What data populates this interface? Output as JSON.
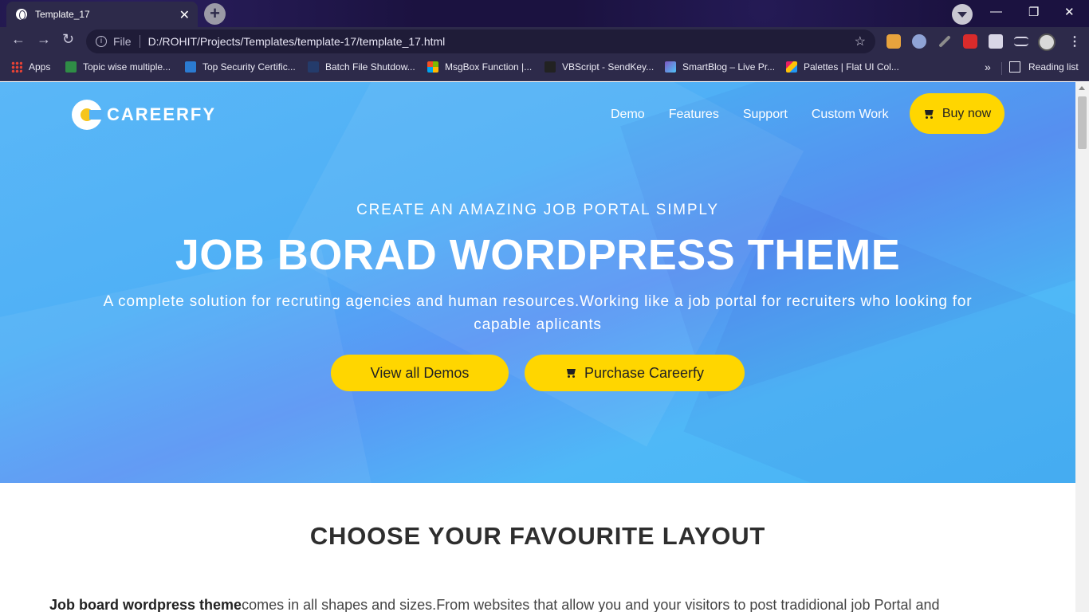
{
  "browser": {
    "tab_title": "Template_17",
    "tab_close": "✕",
    "new_tab": "+",
    "url_scheme": "File",
    "url": "D:/ROHIT/Projects/Templates/template-17/template_17.html",
    "window_controls": [
      "—",
      "❐",
      "✕"
    ],
    "bookmarks": [
      {
        "label": "Apps",
        "icon": "apps-grid-icon",
        "color": "#e94235"
      },
      {
        "label": "Topic wise multiple...",
        "icon": "geeksforgeeks-icon",
        "color": "#2f8d46"
      },
      {
        "label": "Top Security Certific...",
        "icon": "site-icon",
        "color": "#2b7bd1"
      },
      {
        "label": "Batch File Shutdow...",
        "icon": "doc-icon",
        "color": "#243b6b"
      },
      {
        "label": "MsgBox Function |...",
        "icon": "microsoft-icon",
        "color": "#f25022"
      },
      {
        "label": "VBScript - SendKey...",
        "icon": "site-icon",
        "color": "#222222"
      },
      {
        "label": "SmartBlog – Live Pr...",
        "icon": "smartblog-icon",
        "color": "#7e57c2"
      },
      {
        "label": "Palettes | Flat UI Col...",
        "icon": "palette-icon",
        "color": "#e91e63"
      }
    ],
    "bookmarks_more": "»",
    "reading_list": "Reading list"
  },
  "site": {
    "logo_text": "CAREERFY",
    "nav": [
      "Demo",
      "Features",
      "Support",
      "Custom Work"
    ],
    "buy_now": "Buy now",
    "kicker": "CREATE AN AMAZING JOB PORTAL SIMPLY",
    "headline": "JOB BORAD WORDPRESS THEME",
    "lede": "A complete solution for recruting agencies and human resources.Working like a job portal for recruiters who looking for capable aplicants",
    "btn_demos": "View all Demos",
    "btn_purchase": "Purchase Careerfy",
    "section_title": "CHOOSE YOUR FAVOURITE LAYOUT",
    "intro_bold": "Job board wordpress theme",
    "intro_rest": "comes in all shapes and sizes.From websites that allow you and your visitors to post tradidional job Portal and"
  },
  "colors": {
    "accent_yellow": "#ffd600",
    "hero_blue": "#4fb0f6",
    "chrome_dark": "#2d2a4a"
  }
}
